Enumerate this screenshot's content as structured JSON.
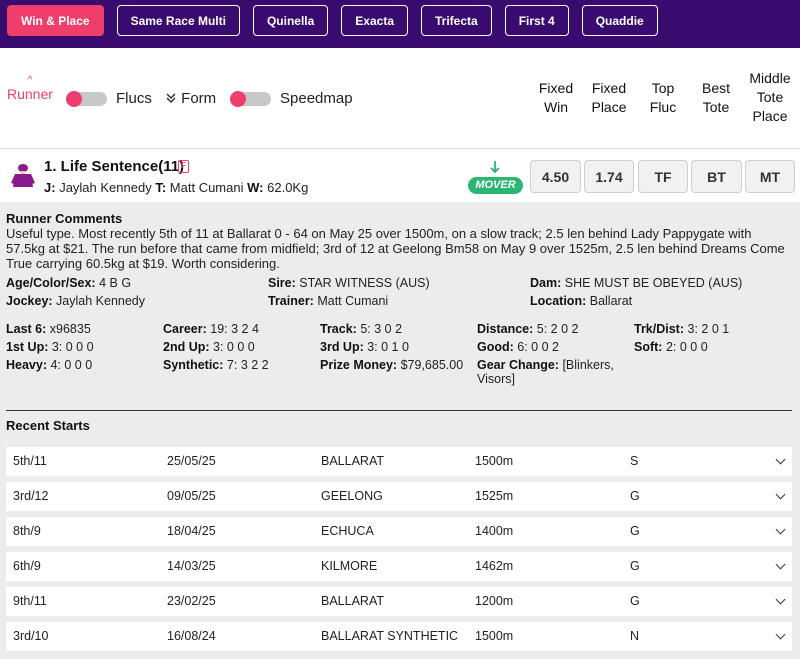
{
  "bet_tabs": [
    "Win & Place",
    "Same Race Multi",
    "Quinella",
    "Exacta",
    "Trifecta",
    "First 4",
    "Quaddie"
  ],
  "header": {
    "runner_label": "Runner",
    "sort_caret": "^",
    "flucs_label": "Flucs",
    "form_label": "Form",
    "speedmap_label": "Speedmap",
    "columns": [
      [
        "Fixed",
        "Win"
      ],
      [
        "Fixed",
        "Place"
      ],
      [
        "Top",
        "Fluc"
      ],
      [
        "Best",
        "Tote"
      ],
      [
        "Middle",
        "Tote",
        "Place"
      ]
    ]
  },
  "runner": {
    "name": "1. Life Sentence(11)",
    "form_icon": "F",
    "jockey_key": "J:",
    "jockey": "Jaylah Kennedy",
    "trainer_key": "T:",
    "trainer": "Matt Cumani",
    "weight_key": "W:",
    "weight": "62.0Kg",
    "mover_badge": "MOVER",
    "odds": [
      "4.50",
      "1.74",
      "TF",
      "BT",
      "MT"
    ],
    "colors": {
      "silks": "#8a1a8c",
      "mover": "#2bb673",
      "accent": "#ef3d6c"
    }
  },
  "comments": {
    "title": "Runner Comments",
    "text": "Useful type. Most recently 5th of 11 at Ballarat 0 - 64 on May 25 over 1500m, on a slow track; 2.5 len behind Lady Pappygate with 57.5kg at $21. The run before that came from midfield; 3rd of 12 at Geelong Bm58 on May 9 over 1525m, 2.5 len behind Dreams Come True carrying 60.5kg at $19. Worth considering."
  },
  "details": [
    {
      "k": "Age/Color/Sex:",
      "v": "4 B G"
    },
    {
      "k": "Sire:",
      "v": "STAR WITNESS (AUS)"
    },
    {
      "k": "Dam:",
      "v": "SHE MUST BE OBEYED (AUS)"
    },
    {
      "k": "Jockey:",
      "v": "Jaylah Kennedy"
    },
    {
      "k": "Trainer:",
      "v": "Matt Cumani"
    },
    {
      "k": "Location:",
      "v": "Ballarat"
    }
  ],
  "stats": [
    {
      "k": "Last 6:",
      "v": "x96835"
    },
    {
      "k": "Career:",
      "v": "19: 3 2 4"
    },
    {
      "k": "Track:",
      "v": "5: 3 0 2"
    },
    {
      "k": "Distance:",
      "v": "5: 2 0 2"
    },
    {
      "k": "Trk/Dist:",
      "v": "3: 2 0 1"
    },
    {
      "k": "1st Up:",
      "v": "3: 0 0 0"
    },
    {
      "k": "2nd Up:",
      "v": "3: 0 0 0"
    },
    {
      "k": "3rd Up:",
      "v": "3: 0 1 0"
    },
    {
      "k": "Good:",
      "v": "6: 0 0 2"
    },
    {
      "k": "Soft:",
      "v": "2: 0 0 0"
    },
    {
      "k": "Heavy:",
      "v": "4: 0 0 0"
    },
    {
      "k": "Synthetic:",
      "v": "7: 3 2 2"
    },
    {
      "k": "Prize Money:",
      "v": "$79,685.00"
    },
    {
      "k": "Gear Change:",
      "v": "[Blinkers, Visors]"
    }
  ],
  "recent": {
    "title": "Recent Starts",
    "rows": [
      {
        "pos": "5th/11",
        "date": "25/05/25",
        "track": "BALLARAT",
        "dist": "1500m",
        "cond": "S"
      },
      {
        "pos": "3rd/12",
        "date": "09/05/25",
        "track": "GEELONG",
        "dist": "1525m",
        "cond": "G"
      },
      {
        "pos": "8th/9",
        "date": "18/04/25",
        "track": "ECHUCA",
        "dist": "1400m",
        "cond": "G"
      },
      {
        "pos": "6th/9",
        "date": "14/03/25",
        "track": "KILMORE",
        "dist": "1462m",
        "cond": "G"
      },
      {
        "pos": "9th/11",
        "date": "23/02/25",
        "track": "BALLARAT",
        "dist": "1200m",
        "cond": "G"
      },
      {
        "pos": "3rd/10",
        "date": "16/08/24",
        "track": "BALLARAT SYNTHETIC",
        "dist": "1500m",
        "cond": "N"
      }
    ]
  }
}
